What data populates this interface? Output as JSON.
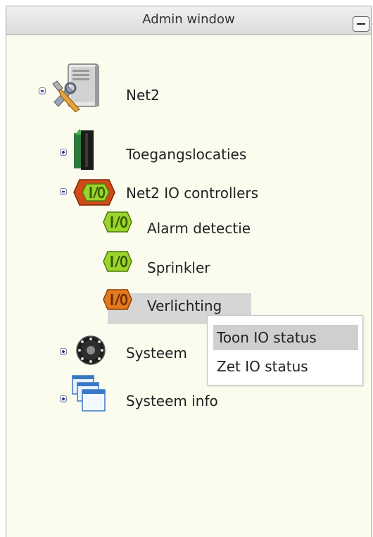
{
  "window": {
    "title": "Admin window"
  },
  "tree": {
    "root": {
      "label": "Net2",
      "icon": "server-tools-icon"
    },
    "toegang": {
      "label": "Toegangslocaties",
      "icon": "door-icon"
    },
    "io_controllers": {
      "label": "Net2 IO controllers",
      "icon": "io-controller-icon"
    },
    "alarm": {
      "label": "Alarm detectie",
      "icon": "io-green-icon"
    },
    "sprinkler": {
      "label": "Sprinkler",
      "icon": "io-green-icon"
    },
    "verlichting": {
      "label": "Verlichting",
      "icon": "io-orange-icon",
      "selected": true
    },
    "systeem": {
      "label": "Systeem",
      "icon": "dial-icon"
    },
    "systeem_info": {
      "label": "Systeem info",
      "icon": "windows-icon"
    }
  },
  "context_menu": {
    "items": [
      "Toon IO status",
      "Zet IO status"
    ],
    "highlighted": 0
  },
  "colors": {
    "window_bg": "#fbfbee",
    "selection": "#d6d6d6",
    "io_green": "#9bd42a",
    "io_orange": "#e37a1e"
  }
}
